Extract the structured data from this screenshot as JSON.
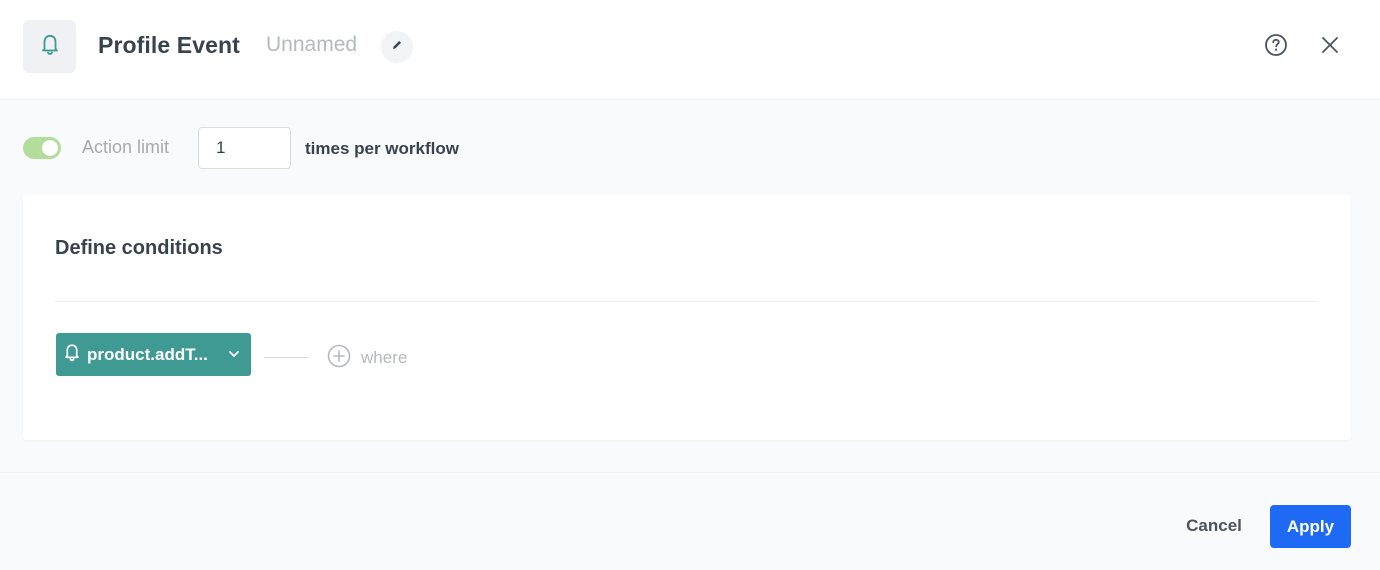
{
  "header": {
    "title": "Profile Event",
    "name": "Unnamed",
    "icon": "bell-icon",
    "edit_icon": "pencil-icon",
    "help_icon": "help-circle-icon",
    "close_icon": "close-icon"
  },
  "action_limit": {
    "enabled": true,
    "label": "Action limit",
    "value": "1",
    "suffix": "times per workflow"
  },
  "conditions": {
    "title": "Define conditions",
    "event": {
      "label": "product.addT...",
      "icon": "bell-icon",
      "dropdown_icon": "chevron-down-icon"
    },
    "where": {
      "label": "where",
      "icon": "plus-circle-icon"
    }
  },
  "footer": {
    "cancel_label": "Cancel",
    "apply_label": "Apply"
  },
  "colors": {
    "accent_teal": "#3f9a93",
    "toggle_on": "#b3dd9c",
    "primary_blue": "#1f6af5",
    "text_dark": "#384350",
    "text_muted": "#b5b9bf"
  }
}
